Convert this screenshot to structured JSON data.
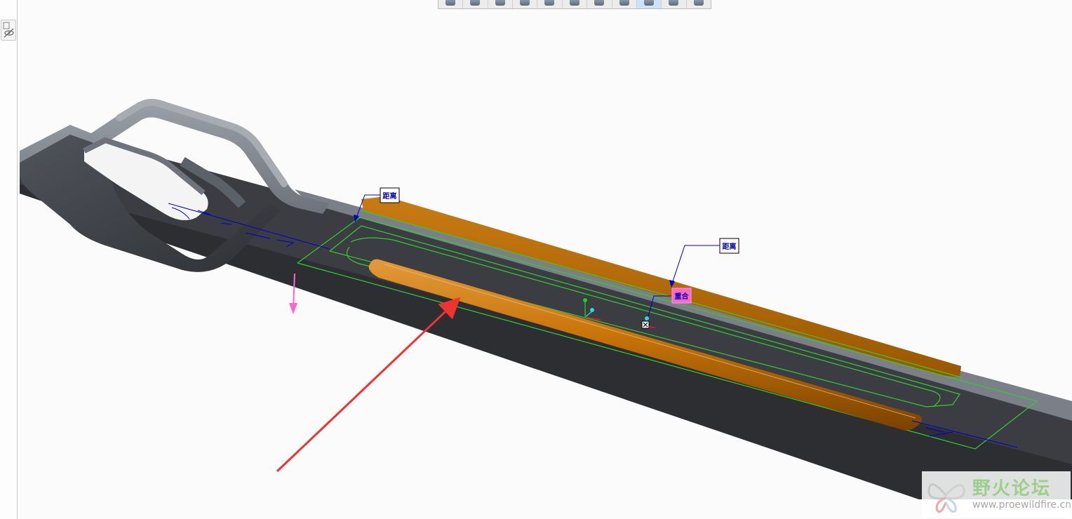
{
  "toolbar": {
    "buttons": [
      {
        "icon": "view-icon"
      },
      {
        "icon": "sketch-line-icon"
      },
      {
        "icon": "sketch-arc-icon"
      },
      {
        "icon": "shaded-view-icon"
      },
      {
        "icon": "display-style-icon"
      },
      {
        "icon": "saved-views-icon"
      },
      {
        "icon": "camera-icon"
      },
      {
        "icon": "csys-display-icon"
      },
      {
        "icon": "datum-point-icon",
        "active": true
      },
      {
        "icon": "annotation-visibility-icon"
      },
      {
        "icon": "glasses-icon"
      }
    ]
  },
  "left_panel": {
    "tool_icon": "layer-eye-icon"
  },
  "annotations": {
    "distance_1": "距离",
    "distance_2": "距离",
    "coincident": "重合"
  },
  "watermark": {
    "title": "野火论坛",
    "url": "www.proewildfire.cn"
  },
  "colors": {
    "model_dark": "#3b3d42",
    "model_light": "#777c85",
    "feature_orange": "#b56a00",
    "sketch_green": "#33cc33",
    "dimension_blue": "#0000cc",
    "highlight_pink": "#ff66cc",
    "arrow_red": "#ee3333"
  }
}
